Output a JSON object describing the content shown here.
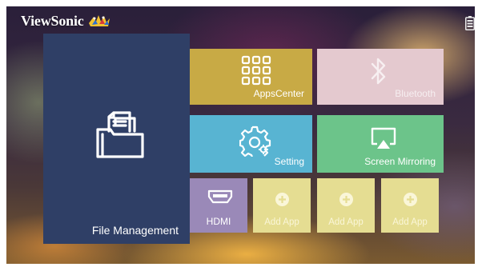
{
  "brand": {
    "name": "ViewSonic"
  },
  "tiles": {
    "file_management": {
      "label": "File Management",
      "icon": "folder-files-icon",
      "color": "#2f3f66"
    },
    "apps_center": {
      "label": "AppsCenter",
      "icon": "apps-grid-icon",
      "color": "#c8aa45"
    },
    "bluetooth": {
      "label": "Bluetooth",
      "icon": "bluetooth-icon",
      "color": "#e4c9cf"
    },
    "setting": {
      "label": "Setting",
      "icon": "gear-icon",
      "color": "#58b4d2"
    },
    "screen_mirroring": {
      "label": "Screen Mirroring",
      "icon": "screen-mirroring-icon",
      "color": "#6cc48a"
    },
    "hdmi": {
      "label": "HDMI",
      "icon": "hdmi-icon",
      "color": "#9a89b8"
    },
    "add_apps": [
      {
        "label": "Add App",
        "icon": "plus-circle-icon",
        "color": "#e5dd92"
      },
      {
        "label": "Add App",
        "icon": "plus-circle-icon",
        "color": "#e5dd92"
      },
      {
        "label": "Add App",
        "icon": "plus-circle-icon",
        "color": "#e5dd92"
      }
    ]
  },
  "status": {
    "icon": "battery-icon"
  }
}
